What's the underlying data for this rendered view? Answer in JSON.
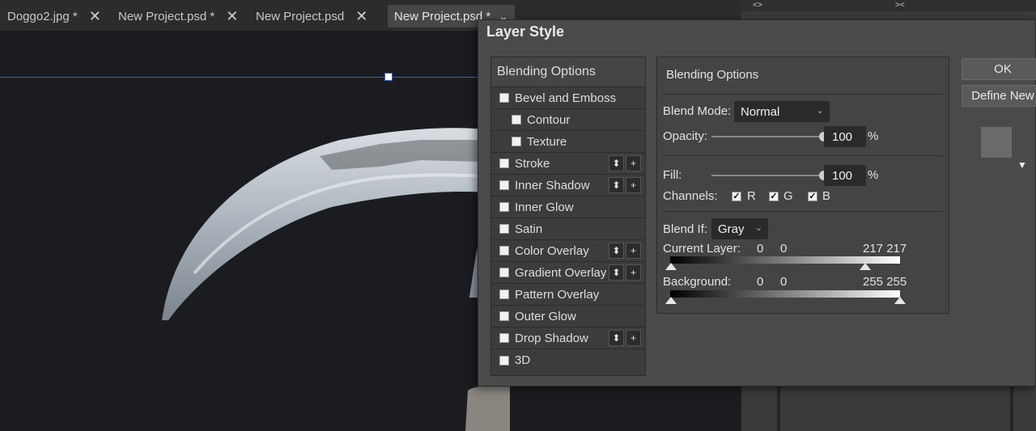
{
  "tabs": [
    {
      "label": "Doggo2.jpg *",
      "close": "✕"
    },
    {
      "label": "New Project.psd *",
      "close": "✕"
    },
    {
      "label": "New Project.psd",
      "close": "✕"
    },
    {
      "label": "New Project.psd *",
      "close": "⌄"
    }
  ],
  "right_panel": {
    "left_glyph": "<>",
    "right_glyph": "><"
  },
  "dialog": {
    "title": "Layer Style",
    "list_header": "Blending Options",
    "list_items": [
      {
        "label": "Bevel and Emboss",
        "checked": false
      },
      {
        "label": "Contour",
        "checked": false
      },
      {
        "label": "Texture",
        "checked": false
      },
      {
        "label": "Stroke",
        "checked": false
      },
      {
        "label": "Inner Shadow",
        "checked": false
      },
      {
        "label": "Inner Glow",
        "checked": false
      },
      {
        "label": "Satin",
        "checked": false
      },
      {
        "label": "Color Overlay",
        "checked": false
      },
      {
        "label": "Gradient Overlay",
        "checked": false
      },
      {
        "label": "Pattern Overlay",
        "checked": false
      },
      {
        "label": "Outer Glow",
        "checked": false
      },
      {
        "label": "Drop Shadow",
        "checked": false
      },
      {
        "label": "3D",
        "checked": false
      }
    ],
    "controls": {
      "move": "⬍",
      "add": "+"
    },
    "panel": {
      "title": "Blending Options",
      "blend_mode_label": "Blend Mode:",
      "blend_mode_value": "Normal",
      "opacity_label": "Opacity:",
      "opacity_value": "100",
      "opacity_unit": "%",
      "fill_label": "Fill:",
      "fill_value": "100",
      "fill_unit": "%",
      "channels_label": "Channels:",
      "channels": [
        {
          "label": "R",
          "checked": true
        },
        {
          "label": "G",
          "checked": true
        },
        {
          "label": "B",
          "checked": true
        }
      ],
      "blend_if_label": "Blend If:",
      "blend_if_value": "Gray",
      "current_layer_label": "Current Layer:",
      "current_layer_low": "0",
      "current_layer_low2": "0",
      "current_layer_high": "217 217",
      "background_label": "Background:",
      "background_low": "0",
      "background_low2": "0",
      "background_high": "255 255"
    },
    "ok_label": "OK",
    "define_new_label": "Define New",
    "dropdown_arrow": "▼"
  },
  "colors": {
    "guide_line": "#3f63b8",
    "canvas_bg": "#1b1c20",
    "dialog_bg": "#4a4a4a"
  }
}
